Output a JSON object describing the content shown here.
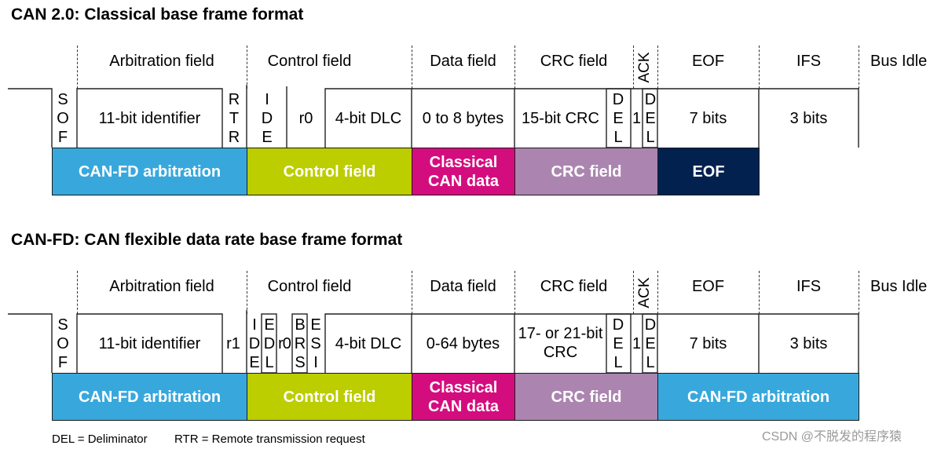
{
  "frames": [
    {
      "title": "CAN 2.0: Classical base frame format",
      "headers": {
        "arbitration": "Arbitration field",
        "control": "Control field",
        "data": "Data field",
        "crc": "CRC field",
        "ack": "ACK",
        "eof": "EOF",
        "ifs": "IFS",
        "bus_idle": "Bus Idle"
      },
      "bits": {
        "sof": [
          "S",
          "O",
          "F"
        ],
        "identifier": "11-bit identifier",
        "rtr": [
          "R",
          "T",
          "R"
        ],
        "ide": [
          "I",
          "D",
          "E"
        ],
        "r0": "r0",
        "dlc": "4-bit DLC",
        "data": "0 to 8 bytes",
        "crc": "15-bit CRC",
        "crc_del": [
          "D",
          "E",
          "L"
        ],
        "ack_slot": "1",
        "ack_del": [
          "D",
          "E",
          "L"
        ],
        "eof": "7 bits",
        "ifs": "3 bits"
      },
      "blocks": [
        {
          "label": "CAN-FD arbitration",
          "color": "#38a8dc"
        },
        {
          "label": "Control field",
          "color": "#bccd00"
        },
        {
          "label": "Classical CAN data",
          "color": "#d40d7e"
        },
        {
          "label": "CRC field",
          "color": "#ab85b0"
        },
        {
          "label": "EOF",
          "color": "#03214f"
        }
      ]
    },
    {
      "title": "CAN-FD: CAN flexible data rate base frame format",
      "headers": {
        "arbitration": "Arbitration field",
        "control": "Control field",
        "data": "Data field",
        "crc": "CRC field",
        "ack": "ACK",
        "eof": "EOF",
        "ifs": "IFS",
        "bus_idle": "Bus Idle"
      },
      "bits": {
        "sof": [
          "S",
          "O",
          "F"
        ],
        "identifier": "11-bit identifier",
        "r1": "r1",
        "ide": [
          "I",
          "D",
          "E"
        ],
        "edl": [
          "E",
          "D",
          "L"
        ],
        "r0": "r0",
        "brs": [
          "B",
          "R",
          "S"
        ],
        "esi": [
          "E",
          "S",
          "I"
        ],
        "dlc": "4-bit DLC",
        "data": "0-64 bytes",
        "crc": [
          "17- or 21-bit",
          "CRC"
        ],
        "crc_del": [
          "D",
          "E",
          "L"
        ],
        "ack_slot": "1",
        "ack_del": [
          "D",
          "E",
          "L"
        ],
        "eof": "7 bits",
        "ifs": "3 bits"
      },
      "blocks": [
        {
          "label": "CAN-FD arbitration",
          "color": "#38a8dc"
        },
        {
          "label": "Control field",
          "color": "#bccd00"
        },
        {
          "label": "Classical CAN data",
          "color": "#d40d7e"
        },
        {
          "label": "CRC field",
          "color": "#ab85b0"
        },
        {
          "label": "CAN-FD arbitration",
          "color": "#38a8dc"
        }
      ]
    }
  ],
  "legend": {
    "del": "DEL = Deliminator",
    "rtr": "RTR = Remote transmission request"
  },
  "watermark": "CSDN @不脱发的程序猿"
}
